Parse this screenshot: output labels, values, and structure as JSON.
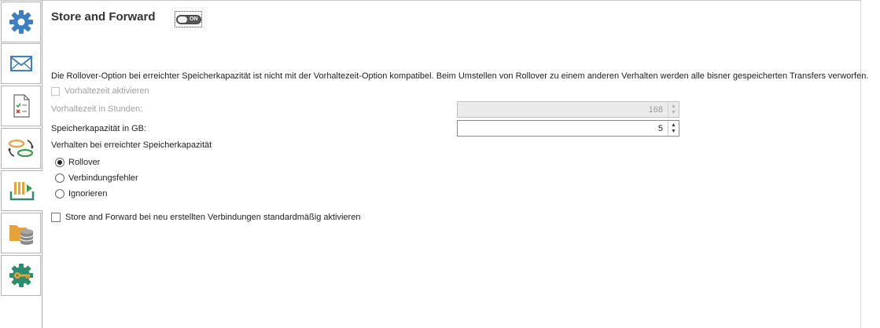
{
  "sidebar": {
    "items": [
      {
        "icon": "gear-icon"
      },
      {
        "icon": "envelope-icon"
      },
      {
        "icon": "checklist-document-icon"
      },
      {
        "icon": "transfer-cycle-icon"
      },
      {
        "icon": "store-forward-icon"
      },
      {
        "icon": "folder-database-icon"
      },
      {
        "icon": "gear-key-icon"
      }
    ],
    "active_index": 4
  },
  "header": {
    "title": "Store and Forward",
    "toggle_label": "ON",
    "toggle_state": "on"
  },
  "notice": "Die Rollover-Option bei erreichter Speicherkapazität ist nicht mit der Vorhaltezeit-Option kompatibel. Beim Umstellen von Rollover zu einem anderen Verhalten werden alle bisner gespeicherten Transfers verworfen.",
  "retention": {
    "checkbox_label": "Vorhaltezeit aktivieren",
    "checked": false,
    "hours_label": "Vorhaltezeit in Stunden:",
    "hours_value": "168"
  },
  "capacity": {
    "label": "Speicherkapazität in GB:",
    "value": "5"
  },
  "behavior": {
    "label": "Verhalten bei erreichter Speicherkapazität",
    "options": [
      "Rollover",
      "Verbindungsfehler",
      "Ignorieren"
    ],
    "selected": "Rollover"
  },
  "default_enable": {
    "label": "Store and Forward bei neu erstellten Verbindungen standardmäßig aktivieren",
    "checked": false
  },
  "colors": {
    "icon_blue": "#3d7fc4",
    "icon_orange": "#e8a23a",
    "icon_green": "#3c9a4a",
    "icon_teal": "#2c8c6e"
  }
}
